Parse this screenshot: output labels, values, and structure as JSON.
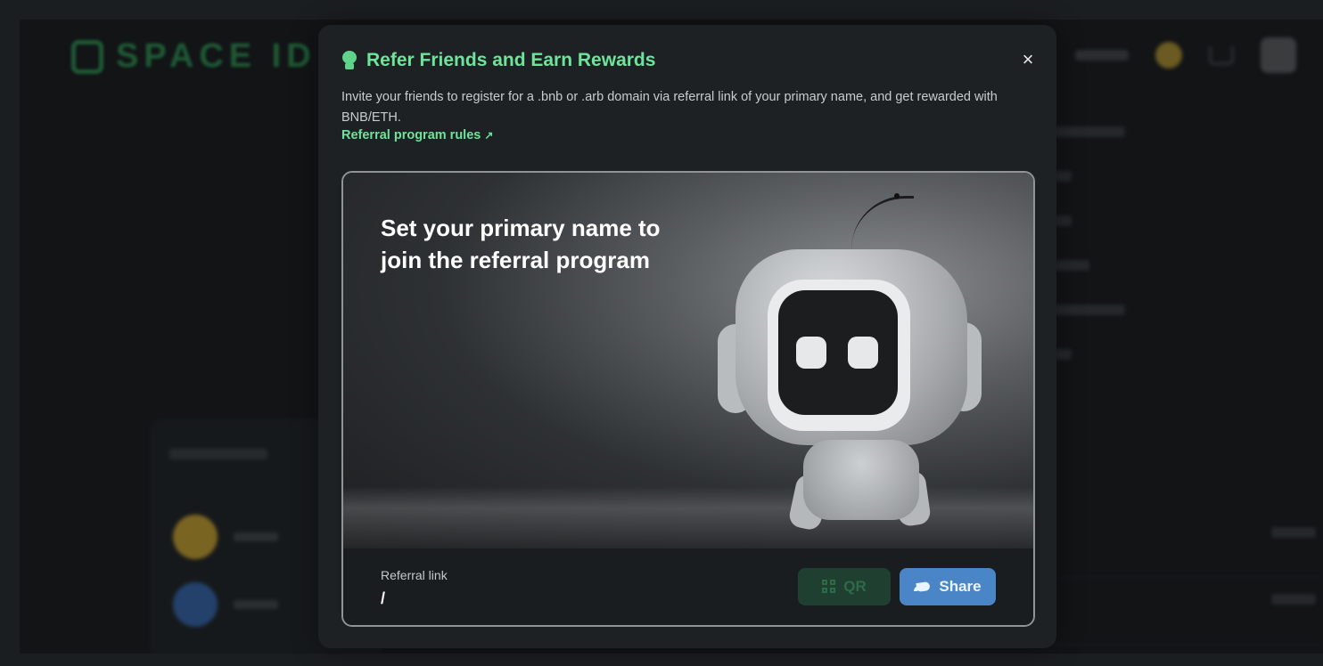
{
  "app": {
    "logo_text": "SPACE ID"
  },
  "modal": {
    "title": "Refer Friends and Earn Rewards",
    "close_icon": "×",
    "description": "Invite your friends to register for a .bnb or .arb domain via referral link of your primary name, and get rewarded with BNB/ETH.",
    "rules_link": "Referral program rules",
    "rules_arrow": "↗",
    "hero_title_line1": "Set your primary name to",
    "hero_title_line2": "join the referral program",
    "referral_label": "Referral link",
    "referral_value": "/",
    "qr_label": "QR",
    "share_label": "Share",
    "colors": {
      "accent_green": "#6ee49a",
      "share_blue": "#4a86c7",
      "qr_disabled": "#1f4030"
    }
  }
}
